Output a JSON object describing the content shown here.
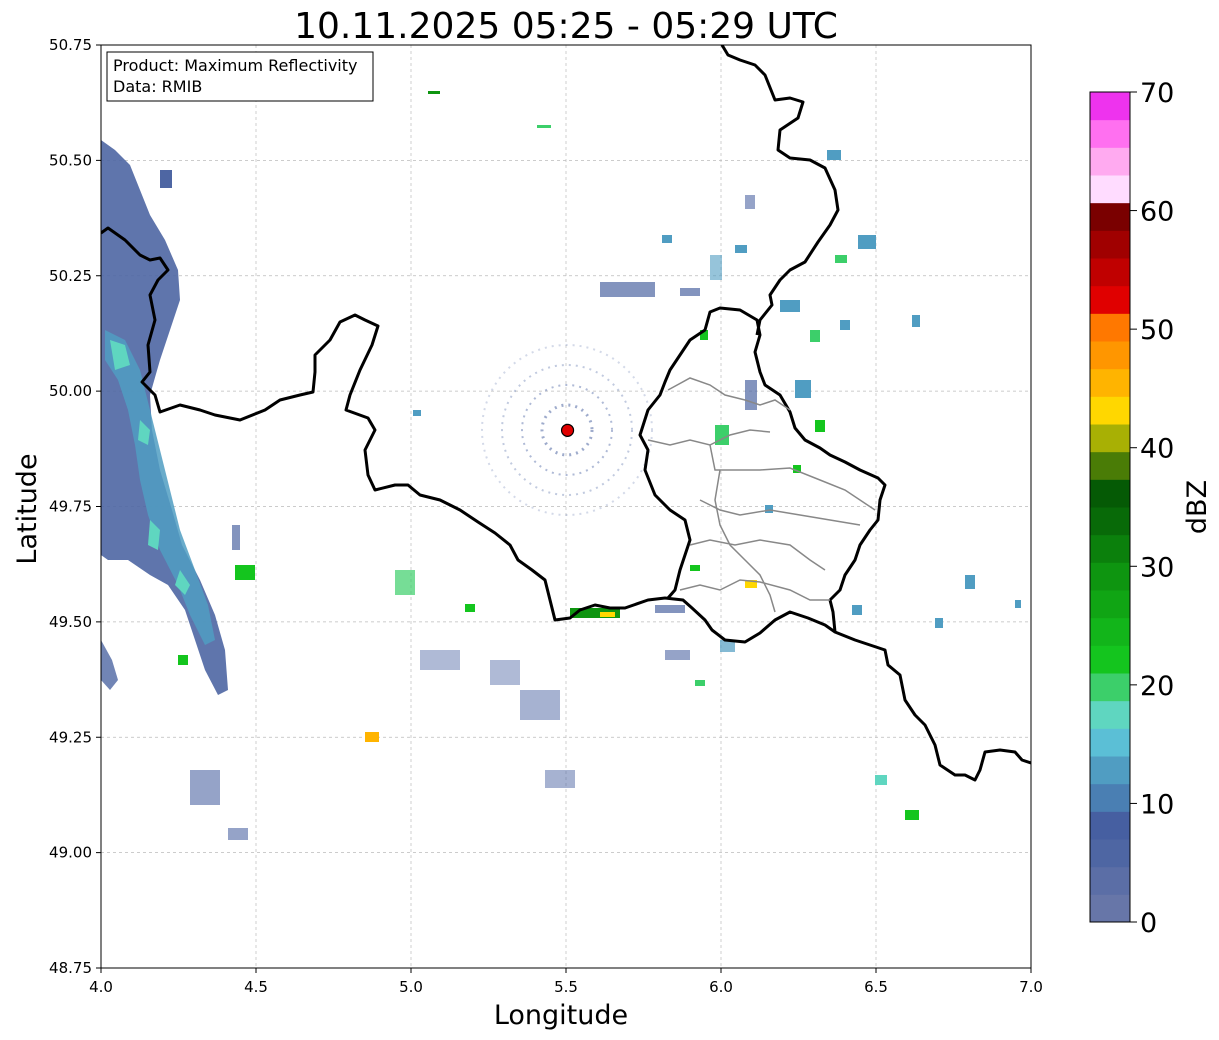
{
  "title": "10.11.2025 05:25 - 05:29 UTC",
  "info_box": {
    "line1": "Product: Maximum Reflectivity",
    "line2": "Data: RMIB"
  },
  "axes": {
    "xlabel": "Longitude",
    "ylabel": "Latitude",
    "xlim": [
      4.0,
      7.0
    ],
    "ylim": [
      48.75,
      50.75
    ],
    "xticks": [
      "4.0",
      "4.5",
      "5.0",
      "5.5",
      "6.0",
      "6.5",
      "7.0"
    ],
    "yticks": [
      "48.75",
      "49.00",
      "49.25",
      "49.50",
      "49.75",
      "50.00",
      "50.25",
      "50.50",
      "50.75"
    ],
    "grid": true
  },
  "radar_site": {
    "lon": 5.505,
    "lat": 49.915,
    "color": "#e00000"
  },
  "colorbar": {
    "label": "dBZ",
    "range": [
      0,
      70
    ],
    "ticks": [
      "0",
      "10",
      "20",
      "30",
      "40",
      "50",
      "60",
      "70"
    ],
    "colors": [
      "#6776a8",
      "#5b6ea6",
      "#4e66a3",
      "#465fa1",
      "#4a7fb3",
      "#509dc2",
      "#5bbfd6",
      "#5fd6c0",
      "#3ccf6a",
      "#14c51e",
      "#12b51a",
      "#10a514",
      "#0e9510",
      "#0b800c",
      "#086a08",
      "#055a05",
      "#4a7c06",
      "#a8b004",
      "#ffd700",
      "#ffb400",
      "#ff9600",
      "#ff7800",
      "#e00000",
      "#c00000",
      "#a00000",
      "#7a0000",
      "#ffdcff",
      "#ffaaf0",
      "#ff70f0",
      "#ee33ee"
    ]
  }
}
